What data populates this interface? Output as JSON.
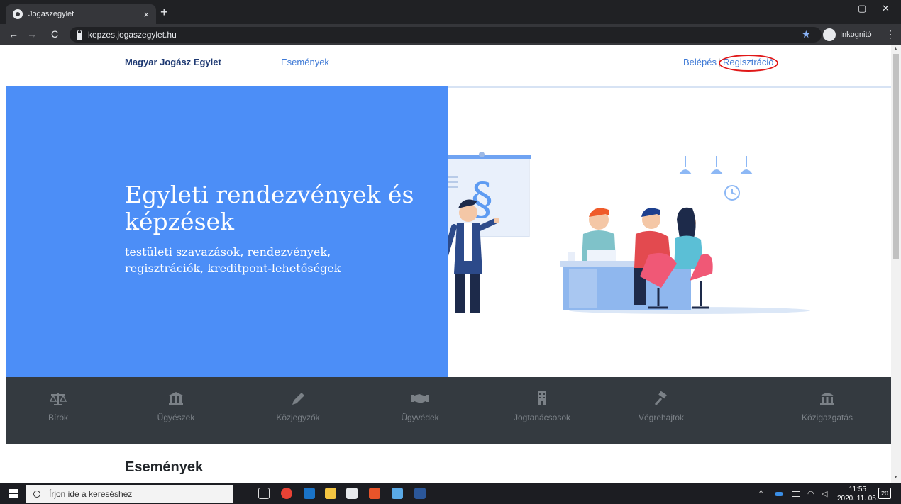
{
  "browser": {
    "tab_title": "Jogászegylet",
    "tab_close": "×",
    "new_tab": "+",
    "url": "kepzes.jogaszegylet.hu",
    "incognito_label": "Inkognitó",
    "window_minimize": "–",
    "window_restore": "▢",
    "window_close": "✕",
    "back": "←",
    "forward": "→",
    "reload": "C",
    "bookmark_star": "★",
    "menu": "⋮"
  },
  "header": {
    "brand": "Magyar Jogász Egylet",
    "nav_events": "Események",
    "login": "Belépés",
    "separator": "|",
    "register": "Regisztráció"
  },
  "hero": {
    "title": "Egyleti rendezvények és képzések",
    "subtitle": "testületi szavazások, rendezvények, regisztrációk, kreditpont-lehetőségek",
    "left_color": "#4c8ef7"
  },
  "categories": [
    {
      "label": "Bírók",
      "icon": "scales-icon"
    },
    {
      "label": "Ügyészek",
      "icon": "courthouse-icon"
    },
    {
      "label": "Közjegyzők",
      "icon": "pen-icon"
    },
    {
      "label": "Ügyvédek",
      "icon": "handshake-icon"
    },
    {
      "label": "Jogtanácsosok",
      "icon": "building-icon"
    },
    {
      "label": "Végrehajtók",
      "icon": "gavel-icon"
    },
    {
      "label": "Közigazgatás",
      "icon": "government-icon"
    }
  ],
  "section": {
    "events_title": "Események"
  },
  "taskbar": {
    "search_placeholder": "Írjon ide a kereséshez",
    "time": "11:55",
    "date": "2020. 11. 05.",
    "notifications": "20"
  }
}
